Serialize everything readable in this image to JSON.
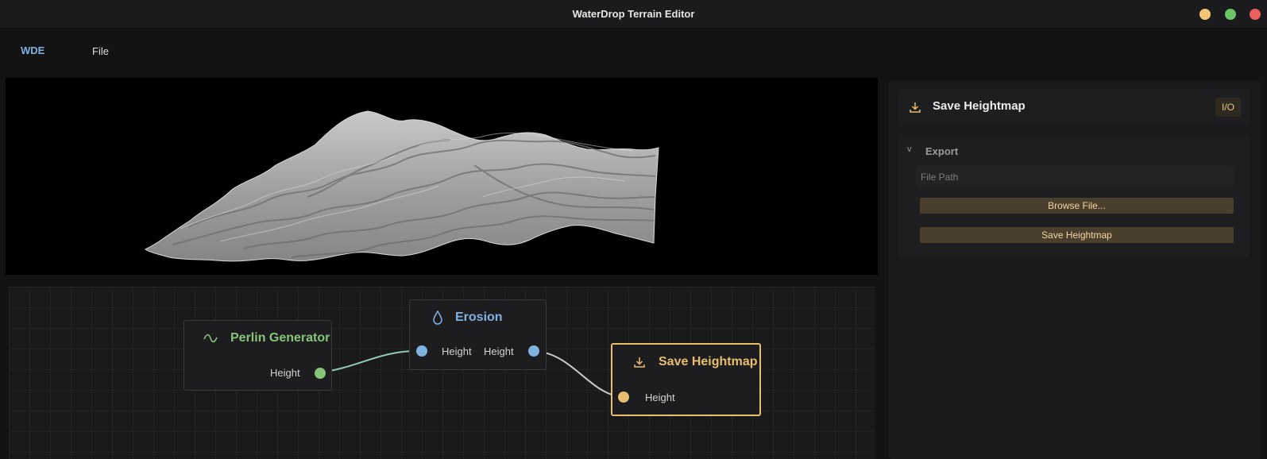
{
  "window": {
    "title": "WaterDrop Terrain Editor"
  },
  "menubar": {
    "brand": "WDE",
    "file_label": "File"
  },
  "colors": {
    "accent_gold": "#e7bd6e",
    "accent_blue": "#7fb2e0",
    "accent_green": "#86c47a"
  },
  "graph": {
    "nodes": {
      "perlin": {
        "title": "Perlin Generator",
        "icon": "wave-icon",
        "output_label": "Height"
      },
      "erosion": {
        "title": "Erosion",
        "icon": "droplet-icon",
        "input_label": "Height",
        "output_label": "Height"
      },
      "save": {
        "title": "Save Heightmap",
        "icon": "download-icon",
        "input_label": "Height"
      }
    }
  },
  "inspector": {
    "title": "Save Heightmap",
    "icon": "download-icon",
    "badge": "I/O",
    "section": {
      "title": "Export",
      "file_path_placeholder": "File Path",
      "browse_label": "Browse File...",
      "save_label": "Save Heightmap"
    }
  }
}
